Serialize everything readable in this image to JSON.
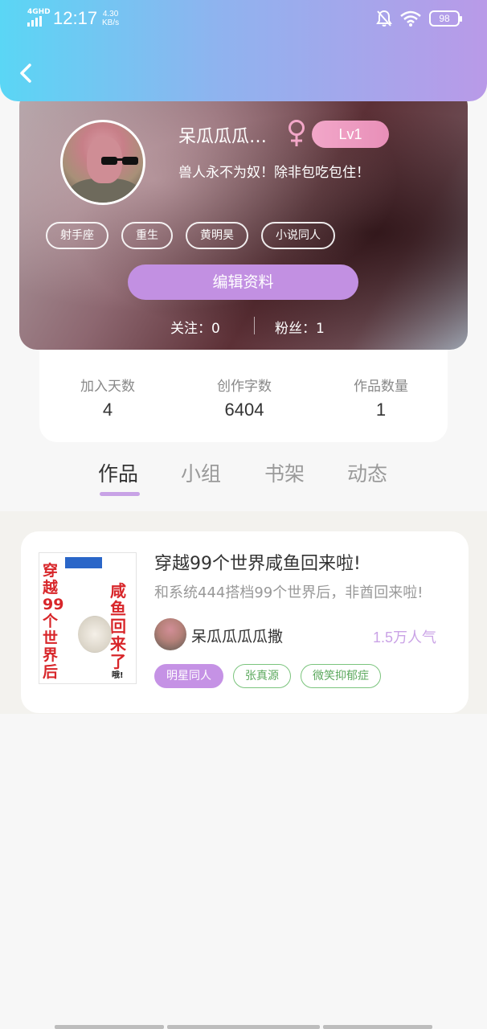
{
  "status_bar": {
    "network": "4GHD",
    "time": "12:17",
    "speed_value": "4.30",
    "speed_unit": "KB/s",
    "battery": "98"
  },
  "profile": {
    "nickname": "呆瓜瓜瓜…",
    "level": "Lv1",
    "signature": "兽人永不为奴！除非包吃包住！",
    "tags": [
      "射手座",
      "重生",
      "黄明昊",
      "小说同人"
    ],
    "edit_button": "编辑资料",
    "following": "关注：0",
    "followers": "粉丝：1",
    "gender_color": "#f3a7c8"
  },
  "stats": [
    {
      "label": "加入天数",
      "value": "4"
    },
    {
      "label": "创作字数",
      "value": "6404"
    },
    {
      "label": "作品数量",
      "value": "1"
    }
  ],
  "tabs": [
    "作品",
    "小组",
    "书架",
    "动态"
  ],
  "active_tab": "作品",
  "work": {
    "title": "穿越99个世界咸鱼回来啦!",
    "description": "和系统444搭档99个世界后，非酋回来啦!",
    "author": "呆瓜瓜瓜瓜撒",
    "popularity": "1.5万人气",
    "tags": [
      {
        "label": "明星同人",
        "style": "filled"
      },
      {
        "label": "张真源",
        "style": "outline"
      },
      {
        "label": "微笑抑郁症",
        "style": "outline"
      }
    ],
    "cover": {
      "text_left": "穿越99个世界后",
      "text_right": "咸鱼回来了",
      "text_bottom": "哦!"
    }
  },
  "colors": {
    "accent_purple": "#c290e2",
    "tag_green": "#7bc47d",
    "header_gradient_start": "#5ad6f5",
    "header_gradient_end": "#b99ae8"
  }
}
